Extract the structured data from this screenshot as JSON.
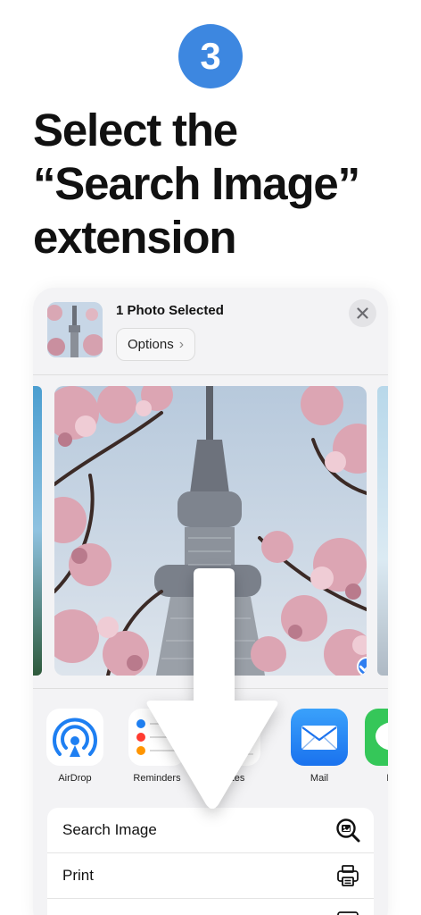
{
  "step": {
    "number": "3",
    "color": "#3d87e0"
  },
  "headline": {
    "line1": "Select the",
    "line2": "“Search Image”",
    "line3": "extension"
  },
  "sheet": {
    "title": "1 Photo Selected",
    "options_label": "Options",
    "close_icon": "close-icon"
  },
  "apps": [
    {
      "label": "AirDrop",
      "icon": "airdrop-icon"
    },
    {
      "label": "Reminders",
      "icon": "reminders-icon"
    },
    {
      "label": "Notes",
      "icon": "notes-icon"
    },
    {
      "label": "Mail",
      "icon": "mail-icon"
    },
    {
      "label": "Me",
      "icon": "messages-icon"
    }
  ],
  "actions": [
    {
      "label": "Search Image",
      "icon": "search-image-icon"
    },
    {
      "label": "Print",
      "icon": "printer-icon"
    },
    {
      "label": "",
      "icon": "more-icon"
    }
  ],
  "colors": {
    "accent": "#2f7ef0",
    "mail": "#2f8ff5",
    "airdrop": "#1e7ff2"
  }
}
